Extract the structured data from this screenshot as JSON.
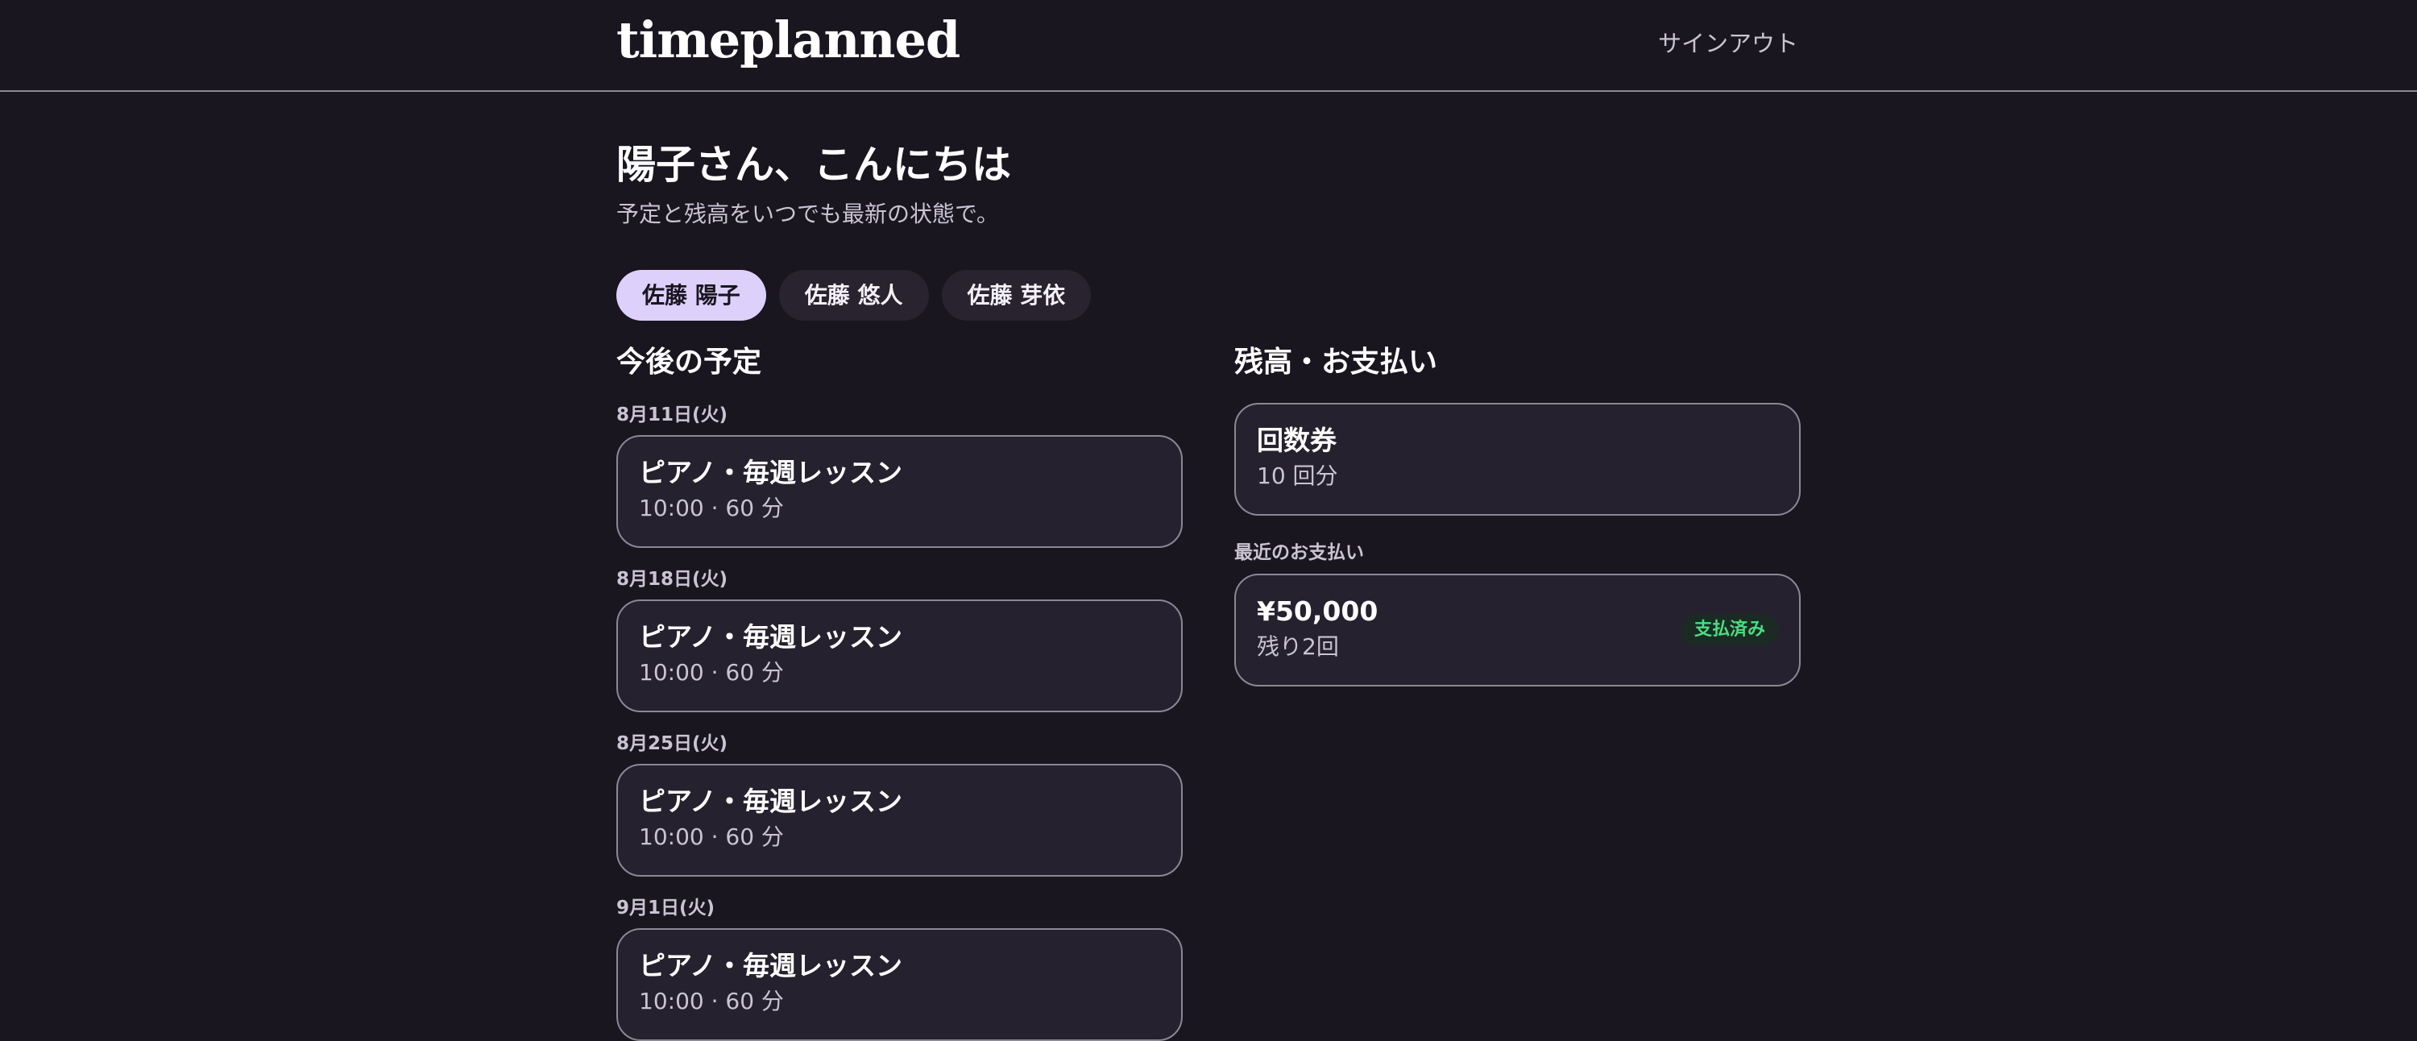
{
  "header": {
    "brand": "timeplanned",
    "signout_label": "サインアウト"
  },
  "greeting": {
    "title": "陽子さん、こんにちは",
    "subtitle": "予定と残高をいつでも最新の状態で。"
  },
  "members": [
    {
      "label": "佐藤 陽子",
      "active": true
    },
    {
      "label": "佐藤 悠人",
      "active": false
    },
    {
      "label": "佐藤 芽依",
      "active": false
    }
  ],
  "schedule": {
    "title": "今後の予定",
    "items": [
      {
        "date": "8月11日(火)",
        "title": "ピアノ・毎週レッスン",
        "detail": "10:00 · 60 分"
      },
      {
        "date": "8月18日(火)",
        "title": "ピアノ・毎週レッスン",
        "detail": "10:00 · 60 分"
      },
      {
        "date": "8月25日(火)",
        "title": "ピアノ・毎週レッスン",
        "detail": "10:00 · 60 分"
      },
      {
        "date": "9月1日(火)",
        "title": "ピアノ・毎週レッスン",
        "detail": "10:00 · 60 分"
      }
    ]
  },
  "balance": {
    "title": "残高・お支払い",
    "ticket": {
      "title": "回数券",
      "detail": "10 回分"
    },
    "recent_label": "最近のお支払い",
    "payment": {
      "amount": "¥50,000",
      "detail": "残り2回",
      "status": "支払済み"
    }
  },
  "colors": {
    "background": "#1a1620",
    "accent_tab": "#ddd0fb",
    "card": "#26212e",
    "status_paid": "#4ade80"
  }
}
